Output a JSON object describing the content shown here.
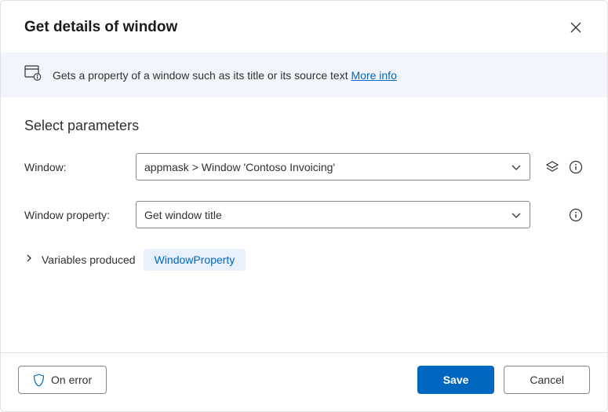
{
  "header": {
    "title": "Get details of window"
  },
  "info": {
    "text": "Gets a property of a window such as its title or its source text ",
    "link_label": "More info"
  },
  "section_title": "Select parameters",
  "form": {
    "window": {
      "label": "Window:",
      "value": "appmask > Window 'Contoso Invoicing'"
    },
    "window_property": {
      "label": "Window property:",
      "value": "Get window title"
    }
  },
  "variables": {
    "label": "Variables produced",
    "value": "WindowProperty"
  },
  "footer": {
    "on_error": "On error",
    "save": "Save",
    "cancel": "Cancel"
  }
}
